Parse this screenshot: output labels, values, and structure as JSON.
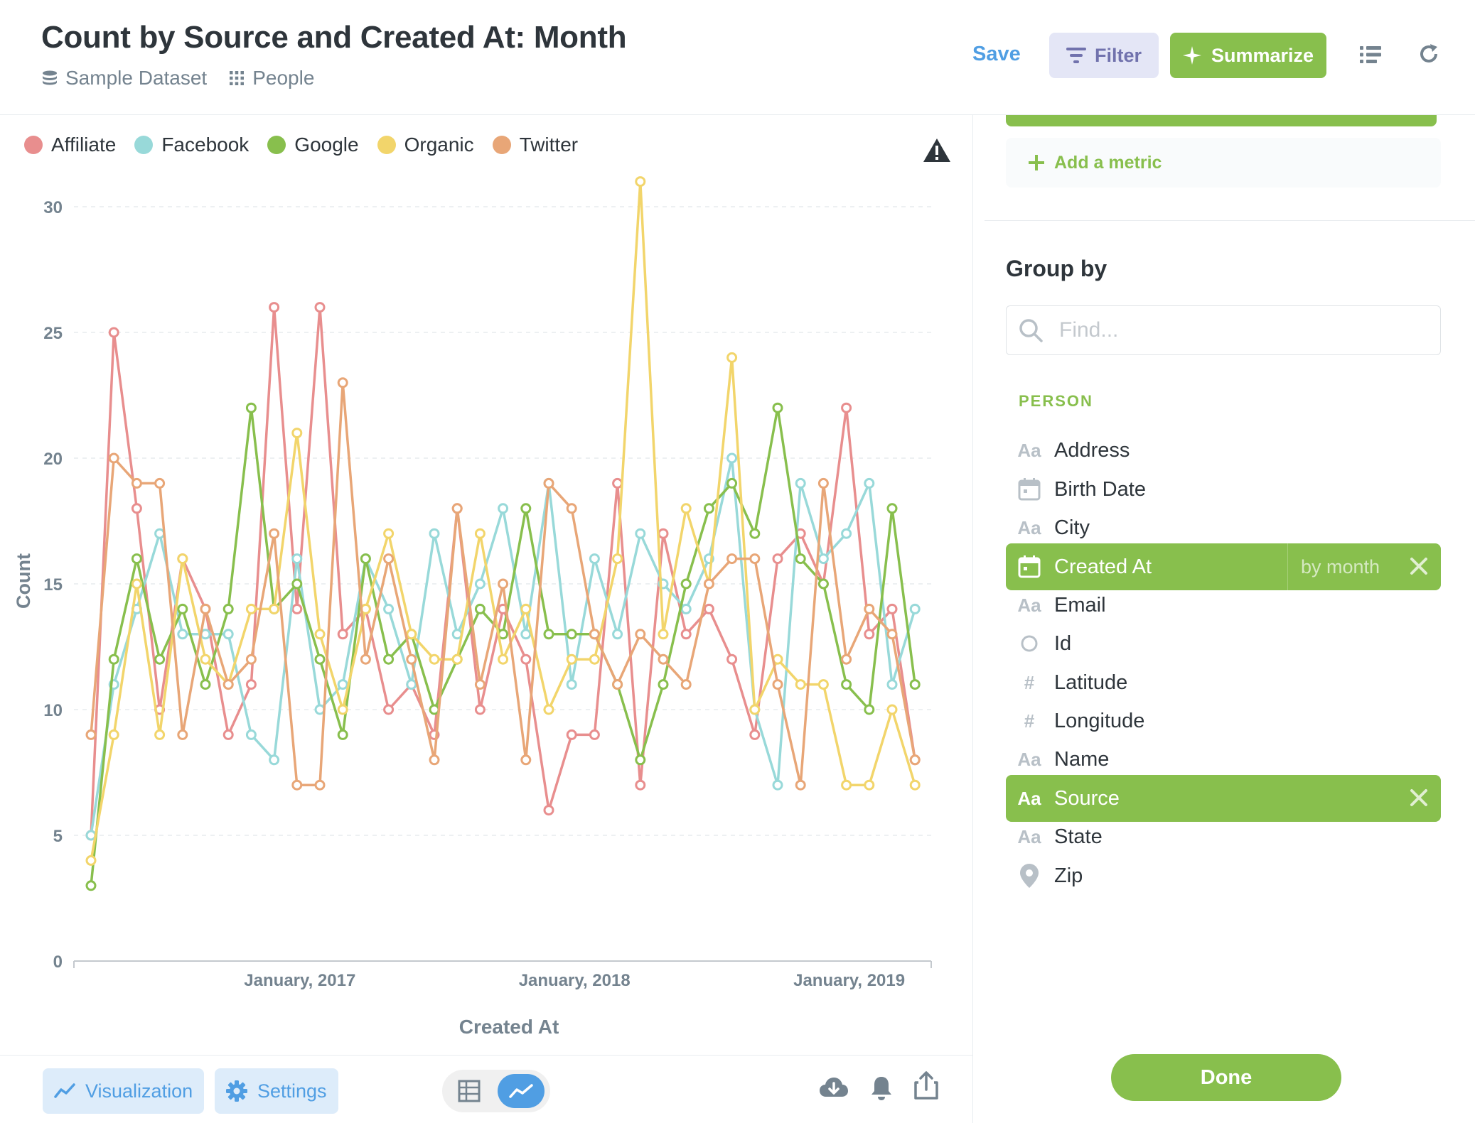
{
  "header": {
    "title": "Count by Source and Created At: Month",
    "dataset": "Sample Dataset",
    "table": "People",
    "save_label": "Save",
    "filter_label": "Filter",
    "summarize_label": "Summarize"
  },
  "sidebar": {
    "add_metric_label": "Add a metric",
    "group_by_title": "Group by",
    "search_placeholder": "Find...",
    "section_label": "PERSON",
    "fields": [
      {
        "name": "Address",
        "icon": "text-icon",
        "active": false
      },
      {
        "name": "Birth Date",
        "icon": "calendar-icon",
        "active": false
      },
      {
        "name": "City",
        "icon": "text-icon",
        "active": false
      },
      {
        "name": "Created At",
        "icon": "calendar-icon",
        "active": true,
        "bucket": "by month"
      },
      {
        "name": "Email",
        "icon": "text-icon",
        "active": false
      },
      {
        "name": "Id",
        "icon": "id-icon",
        "active": false
      },
      {
        "name": "Latitude",
        "icon": "number-icon",
        "active": false
      },
      {
        "name": "Longitude",
        "icon": "number-icon",
        "active": false
      },
      {
        "name": "Name",
        "icon": "text-icon",
        "active": false
      },
      {
        "name": "Source",
        "icon": "text-icon",
        "active": true
      },
      {
        "name": "State",
        "icon": "text-icon",
        "active": false
      },
      {
        "name": "Zip",
        "icon": "location-icon",
        "active": false
      }
    ],
    "text_icon_glyph": "Aa",
    "number_icon_glyph": "#",
    "done_label": "Done"
  },
  "footer": {
    "visualization_label": "Visualization",
    "settings_label": "Settings"
  },
  "colors": {
    "accent_green": "#88bf4d",
    "accent_blue": "#509ee3",
    "filter_purple": "#7172ad"
  },
  "chart_data": {
    "type": "line",
    "xlabel": "Created At",
    "ylabel": "Count",
    "ylim": [
      0,
      30
    ],
    "yticks": [
      0,
      5,
      10,
      15,
      20,
      25,
      30
    ],
    "x_ticks": [
      "January, 2017",
      "January, 2018",
      "January, 2019"
    ],
    "x_tick_index": [
      9,
      21,
      33
    ],
    "legend_position": "top-left",
    "points_count": 37,
    "series": [
      {
        "name": "Affiliate",
        "color": "#e88e8e",
        "values": [
          5,
          25,
          18,
          10,
          16,
          14,
          9,
          11,
          26,
          14,
          26,
          13,
          14,
          10,
          11,
          9,
          18,
          10,
          14,
          12,
          6,
          9,
          9,
          19,
          7,
          17,
          13,
          14,
          12,
          9,
          16,
          17,
          15,
          22,
          13,
          14,
          8
        ]
      },
      {
        "name": "Facebook",
        "color": "#98d9d9",
        "values": [
          5,
          11,
          14,
          17,
          13,
          13,
          13,
          9,
          8,
          16,
          10,
          11,
          16,
          14,
          11,
          17,
          13,
          15,
          18,
          13,
          19,
          11,
          16,
          13,
          17,
          15,
          14,
          16,
          20,
          10,
          7,
          19,
          16,
          17,
          19,
          11,
          14
        ]
      },
      {
        "name": "Google",
        "color": "#88bf4d",
        "values": [
          3,
          12,
          16,
          12,
          14,
          11,
          14,
          22,
          14,
          15,
          12,
          9,
          16,
          12,
          13,
          10,
          12,
          14,
          13,
          18,
          13,
          13,
          13,
          11,
          8,
          11,
          15,
          18,
          19,
          17,
          22,
          16,
          15,
          11,
          10,
          18,
          11
        ]
      },
      {
        "name": "Organic",
        "color": "#f2d56b",
        "values": [
          4,
          9,
          15,
          9,
          16,
          12,
          11,
          14,
          14,
          21,
          13,
          10,
          14,
          17,
          13,
          12,
          12,
          17,
          12,
          14,
          10,
          12,
          12,
          16,
          31,
          13,
          18,
          15,
          24,
          10,
          12,
          11,
          11,
          7,
          7,
          10,
          7
        ]
      },
      {
        "name": "Twitter",
        "color": "#e8a677",
        "values": [
          9,
          20,
          19,
          19,
          9,
          14,
          11,
          12,
          17,
          7,
          7,
          23,
          12,
          16,
          12,
          8,
          18,
          11,
          15,
          8,
          19,
          18,
          13,
          11,
          13,
          12,
          11,
          15,
          16,
          16,
          11,
          7,
          19,
          12,
          14,
          13,
          8
        ]
      }
    ]
  }
}
